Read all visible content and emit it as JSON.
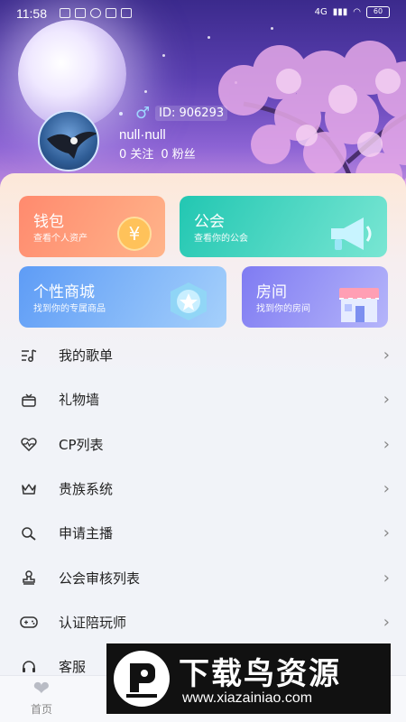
{
  "status_bar": {
    "time": "11:58",
    "battery": "60",
    "signal_text": "4G"
  },
  "profile": {
    "gender_symbol": "♂",
    "id_text": "ID: 906293",
    "nickname": "null·null",
    "follow_count": "0 关注",
    "fans_count": "0 粉丝"
  },
  "cards": [
    {
      "title": "钱包",
      "subtitle": "查看个人资产",
      "icon": "yuan-coin-icon"
    },
    {
      "title": "公会",
      "subtitle": "查看你的公会",
      "icon": "megaphone-icon"
    },
    {
      "title": "个性商城",
      "subtitle": "找到你的专属商品",
      "icon": "star-badge-icon"
    },
    {
      "title": "房间",
      "subtitle": "找到你的房间",
      "icon": "storefront-icon"
    }
  ],
  "menu": [
    {
      "label": "我的歌单",
      "icon": "music-list-icon"
    },
    {
      "label": "礼物墙",
      "icon": "gift-box-icon"
    },
    {
      "label": "CP列表",
      "icon": "heartbeat-icon"
    },
    {
      "label": "贵族系统",
      "icon": "crown-icon"
    },
    {
      "label": "申请主播",
      "icon": "search-person-icon"
    },
    {
      "label": "公会审核列表",
      "icon": "stamp-icon"
    },
    {
      "label": "认证陪玩师",
      "icon": "gamepad-icon"
    },
    {
      "label": "客服",
      "icon": "headset-icon"
    }
  ],
  "bottom_nav": {
    "home_label": "首页"
  },
  "watermark": {
    "title": "下载鸟资源",
    "url": "www.xiazainiao.com"
  }
}
